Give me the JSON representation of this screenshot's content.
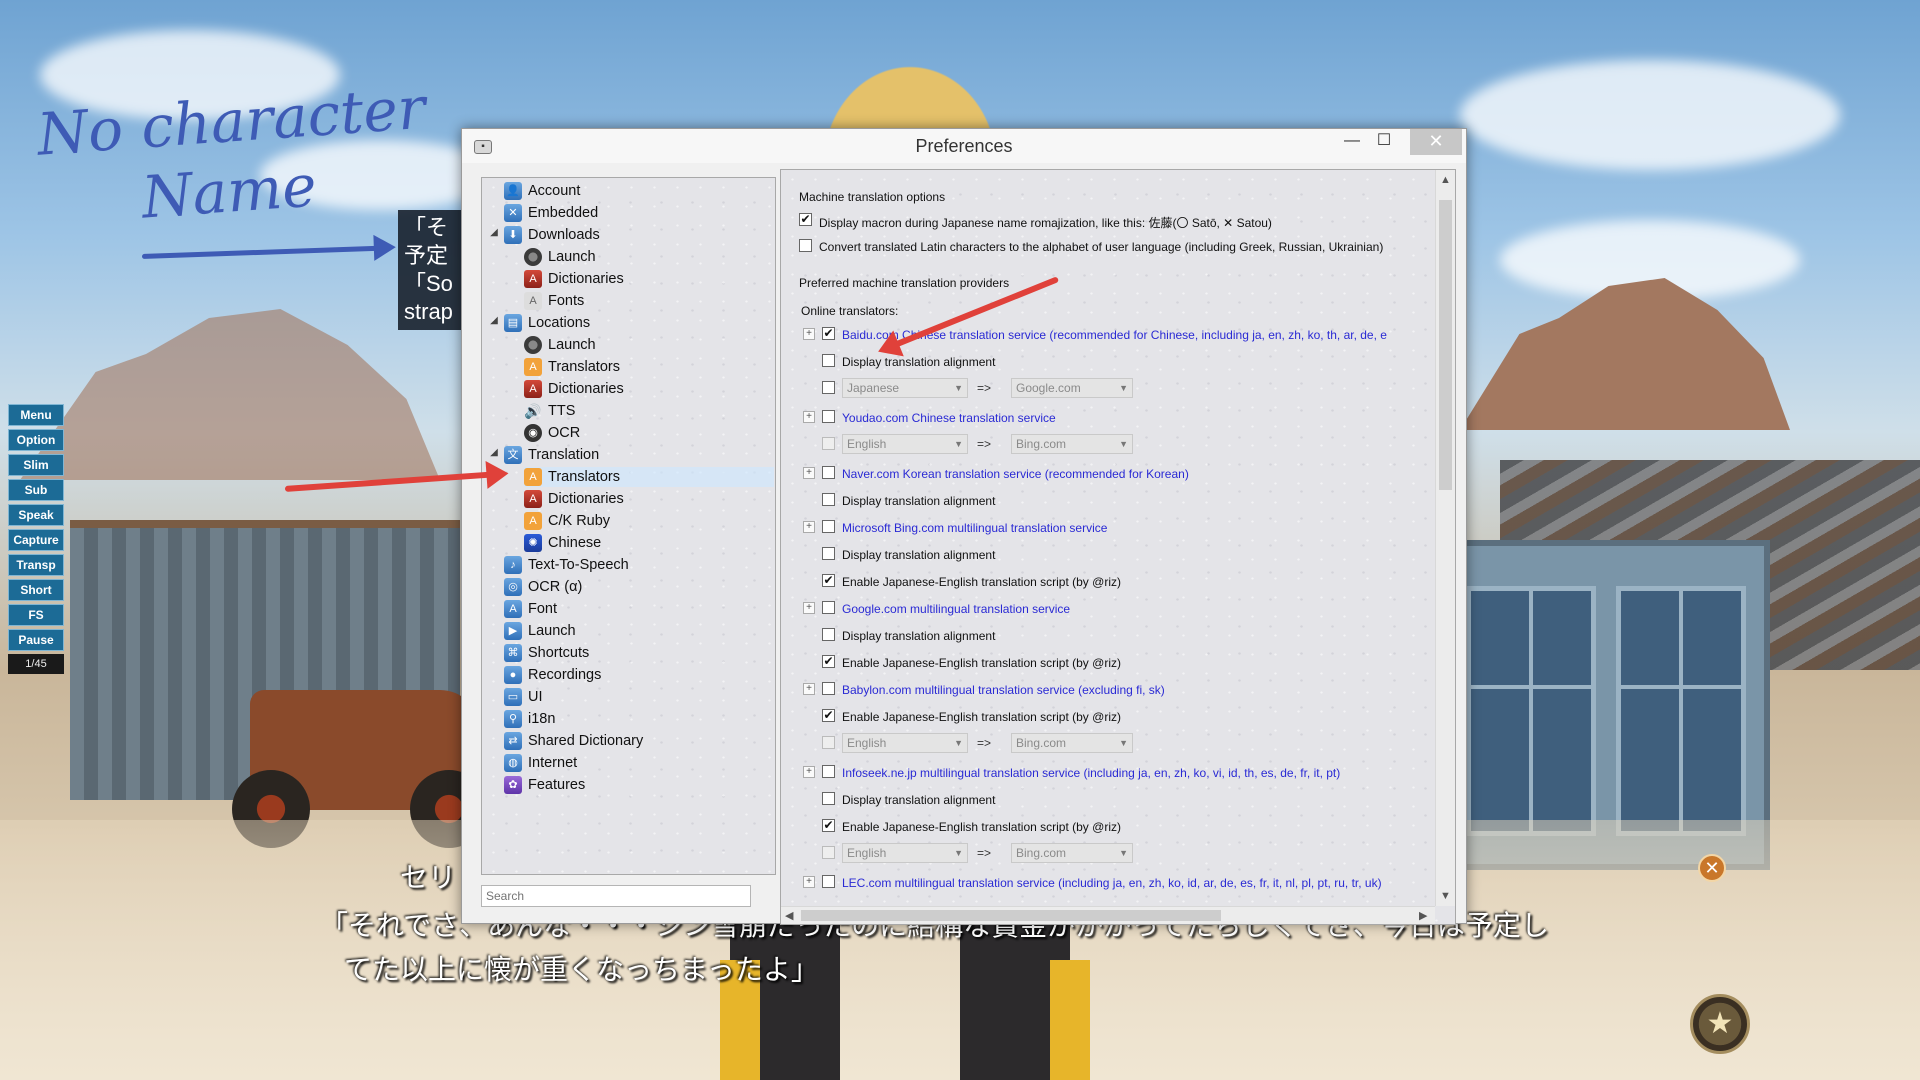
{
  "annotation": {
    "handwritten_line1": "No character",
    "handwritten_line2": "Name"
  },
  "game": {
    "speech_peek_line1": "「そ",
    "speech_peek_line2": "予定",
    "speech_peek_line3": "「So",
    "speech_peek_line4": "strap",
    "subtitle_speaker": "セリ",
    "subtitle_line1": "「それでさ、あんな・・・シン雪崩だったのに結構な賞金がかかってたらしくてさ、今日は予定し",
    "subtitle_line2": "てた以上に懐が重くなっちまったよ」",
    "menu": [
      "Menu",
      "Option",
      "Slim",
      "Sub",
      "Speak",
      "Capture",
      "Transp",
      "Short",
      "FS",
      "Pause"
    ],
    "page_counter": "1/45",
    "close_icon": "close-icon",
    "star_icon": "star-icon"
  },
  "window": {
    "title": "Preferences",
    "minimize_glyph": "—",
    "maximize_glyph": "☐",
    "close_glyph": "✕"
  },
  "nav": {
    "items": [
      {
        "label": "Account",
        "icon": "account-icon"
      },
      {
        "label": "Embedded",
        "icon": "embedded-icon"
      },
      {
        "label": "Downloads",
        "icon": "downloads-icon"
      },
      {
        "label": "Launch",
        "icon": "launch-icon"
      },
      {
        "label": "Dictionaries",
        "icon": "dictionaries-icon"
      },
      {
        "label": "Fonts",
        "icon": "fonts-icon"
      },
      {
        "label": "Locations",
        "icon": "locations-icon"
      },
      {
        "label": "Launch",
        "icon": "launch-icon"
      },
      {
        "label": "Translators",
        "icon": "translators-icon"
      },
      {
        "label": "Dictionaries",
        "icon": "dictionaries-icon"
      },
      {
        "label": "TTS",
        "icon": "speaker-icon"
      },
      {
        "label": "OCR",
        "icon": "ocr-icon"
      },
      {
        "label": "Translation",
        "icon": "translation-icon"
      },
      {
        "label": "Translators",
        "icon": "translators-icon"
      },
      {
        "label": "Dictionaries",
        "icon": "dictionaries-icon"
      },
      {
        "label": "C/K Ruby",
        "icon": "ruby-icon"
      },
      {
        "label": "Chinese",
        "icon": "chinese-icon"
      },
      {
        "label": "Text-To-Speech",
        "icon": "tts-icon"
      },
      {
        "label": "OCR (α)",
        "icon": "ocr-alpha-icon"
      },
      {
        "label": "Font",
        "icon": "font-icon"
      },
      {
        "label": "Launch",
        "icon": "launch-icon"
      },
      {
        "label": "Shortcuts",
        "icon": "shortcuts-icon"
      },
      {
        "label": "Recordings",
        "icon": "recordings-icon"
      },
      {
        "label": "UI",
        "icon": "ui-icon"
      },
      {
        "label": "i18n",
        "icon": "i18n-icon"
      },
      {
        "label": "Shared Dictionary",
        "icon": "shared-dictionary-icon"
      },
      {
        "label": "Internet",
        "icon": "internet-icon"
      },
      {
        "label": "Features",
        "icon": "features-icon"
      }
    ],
    "search_placeholder": "Search"
  },
  "content": {
    "section1_title": "Machine translation options",
    "opt_macron": {
      "label": "Display macron during Japanese name romajization, like this: 佐藤(〇 Satō, ✕ Satou)",
      "checked": true
    },
    "opt_convert": {
      "label": "Convert translated Latin characters to the alphabet of user language (including Greek, Russian, Ukrainian)",
      "checked": false
    },
    "section2_title": "Preferred machine translation providers",
    "online_label": "Online translators:",
    "baidu": {
      "label": "Baidu.com Chinese translation service (recommended for Chinese, including ja, en, zh, ko, th, ar, de, e",
      "checked": true
    },
    "baidu_align": "Display translation alignment",
    "baidu_from": "Japanese",
    "baidu_to": "Google.com",
    "youdao": {
      "label": "Youdao.com Chinese translation service",
      "checked": false
    },
    "youdao_from": "English",
    "youdao_to": "Bing.com",
    "naver": {
      "label": "Naver.com Korean translation service (recommended for Korean)",
      "checked": false
    },
    "naver_align": "Display translation alignment",
    "bing": {
      "label": "Microsoft Bing.com multilingual translation service",
      "checked": false
    },
    "bing_align": "Display translation alignment",
    "bing_script": {
      "label": "Enable Japanese-English translation script (by @riz)",
      "checked": true
    },
    "google": {
      "label": "Google.com multilingual translation service",
      "checked": false
    },
    "google_align": "Display translation alignment",
    "google_script": {
      "label": "Enable Japanese-English translation script (by @riz)",
      "checked": true
    },
    "babylon": {
      "label": "Babylon.com multilingual translation service (excluding fi, sk)",
      "checked": false
    },
    "babylon_script": {
      "label": "Enable Japanese-English translation script (by @riz)",
      "checked": true
    },
    "babylon_from": "English",
    "babylon_to": "Bing.com",
    "infoseek": {
      "label": "Infoseek.ne.jp multilingual translation service (including ja, en, zh, ko, vi, id, th, es, de, fr, it, pt)",
      "checked": false
    },
    "infoseek_align": "Display translation alignment",
    "infoseek_script": {
      "label": "Enable Japanese-English translation script (by @riz)",
      "checked": true
    },
    "infoseek_from": "English",
    "infoseek_to": "Bing.com",
    "lec": {
      "label": "LEC.com multilingual translation service (including ja, en, zh, ko, id, ar, de, es, fr, it, nl, pl, pt, ru, tr, uk)",
      "checked": false
    },
    "arrow_sep": "=>",
    "check_glyph": "✔",
    "expander_glyph": "+"
  }
}
